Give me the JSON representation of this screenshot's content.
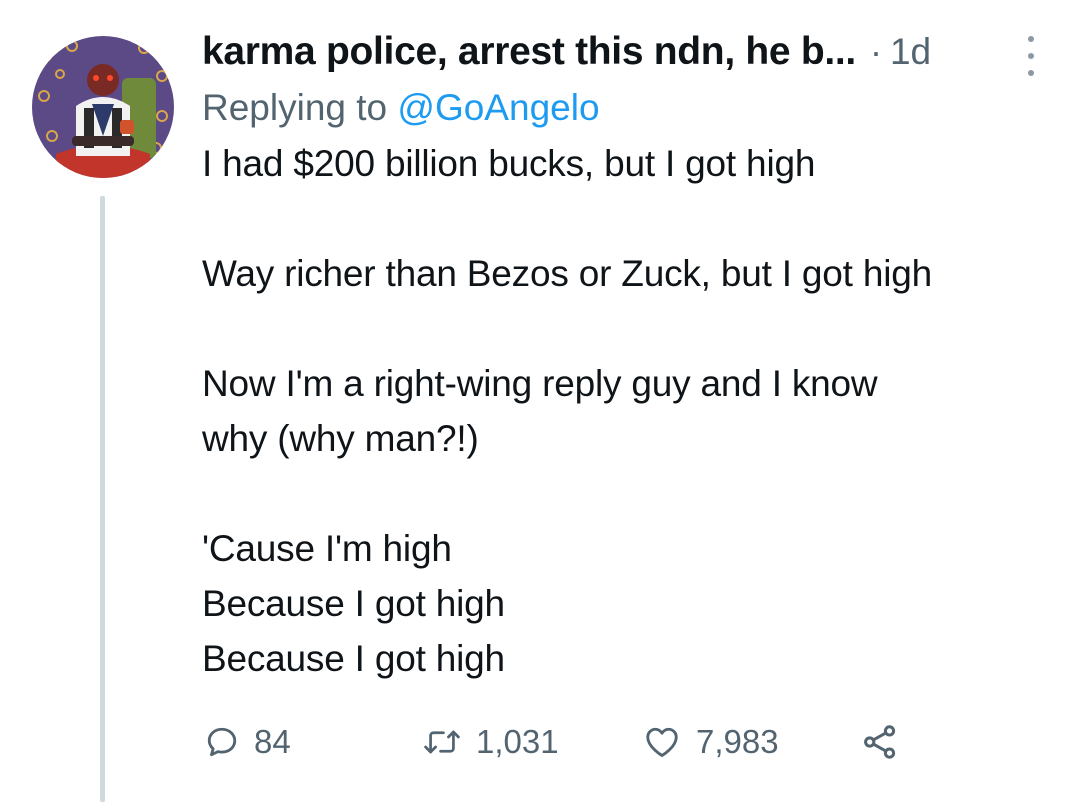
{
  "tweet": {
    "display_name": "karma police, arrest this ndn, he b...",
    "separator": "·",
    "timestamp": "1d",
    "replying_prefix": "Replying to",
    "replying_handle": "@GoAngelo",
    "lines": [
      "I had $200 billion bucks, but I got high",
      "",
      "Way richer than Bezos or Zuck, but I got high",
      "",
      "Now I'm a right-wing reply guy and I know",
      "why (why man?!)",
      "",
      "'Cause I'm high",
      "Because I got high",
      "Because I got high"
    ]
  },
  "actions": {
    "reply_count": "84",
    "retweet_count": "1,031",
    "like_count": "7,983"
  },
  "icons": {
    "reply": "reply-bubble-icon",
    "retweet": "retweet-icon",
    "like": "heart-icon",
    "share": "share-icon",
    "more": "more-vertical-icon"
  },
  "colors": {
    "text": "#0f1419",
    "secondary": "#536471",
    "link": "#1d9bf0",
    "thread_line": "#cfd9de"
  }
}
